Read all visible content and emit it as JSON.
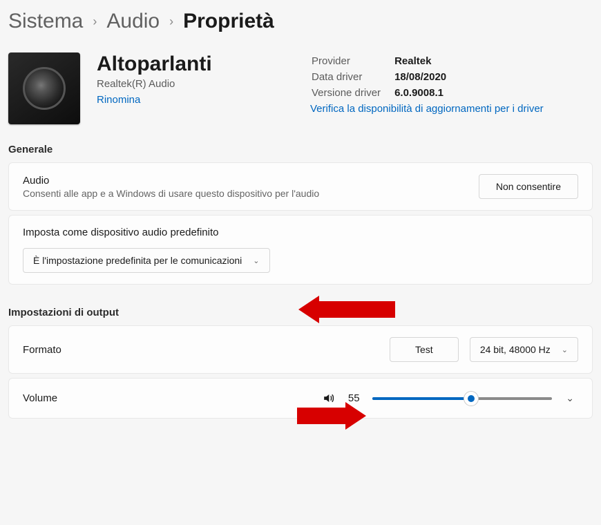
{
  "breadcrumb": {
    "items": [
      "Sistema",
      "Audio"
    ],
    "current": "Proprietà"
  },
  "device": {
    "name": "Altoparlanti",
    "subtitle": "Realtek(R) Audio",
    "rename_label": "Rinomina"
  },
  "driver": {
    "rows": [
      {
        "label": "Provider",
        "value": "Realtek"
      },
      {
        "label": "Data driver",
        "value": "18/08/2020"
      },
      {
        "label": "Versione driver",
        "value": "6.0.9008.1"
      }
    ],
    "update_link": "Verifica la disponibilità di aggiornamenti per i driver"
  },
  "sections": {
    "general": "Generale",
    "output": "Impostazioni di output"
  },
  "audio_card": {
    "title": "Audio",
    "subtitle": "Consenti alle app e a Windows di usare questo dispositivo per l'audio",
    "button": "Non consentire"
  },
  "default_card": {
    "title": "Imposta come dispositivo audio predefinito",
    "selected": "È l'impostazione predefinita per le comunicazioni"
  },
  "format_card": {
    "title": "Formato",
    "test_button": "Test",
    "format_selected": "24 bit, 48000 Hz"
  },
  "volume_card": {
    "title": "Volume",
    "value": 55,
    "percent": 55
  }
}
